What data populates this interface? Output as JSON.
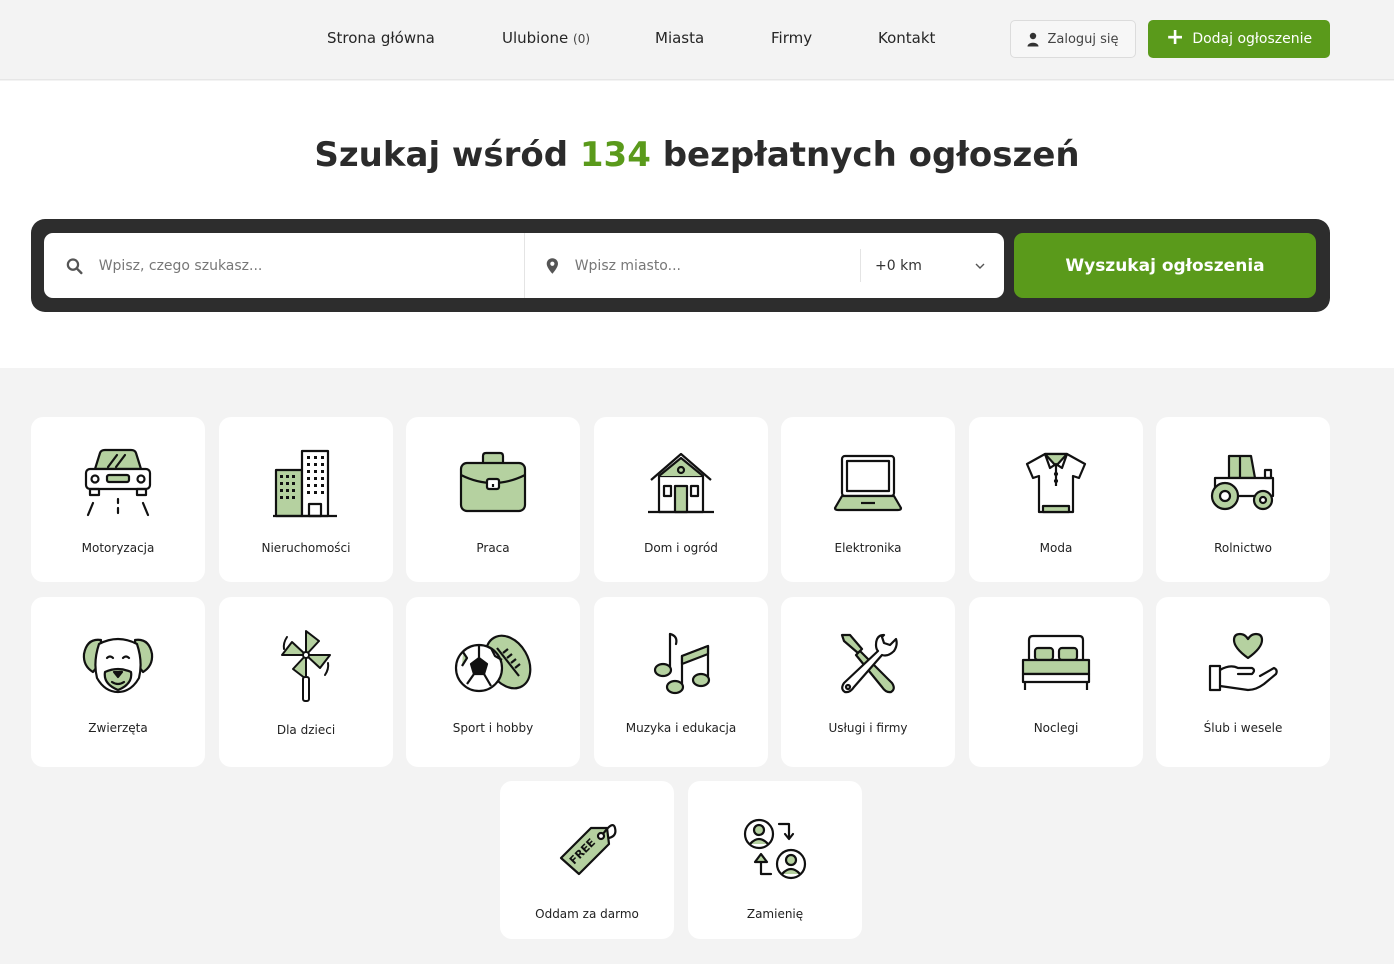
{
  "nav": {
    "items": [
      {
        "label": "Strona główna"
      },
      {
        "label": "Ulubione",
        "count": "(0)"
      },
      {
        "label": "Miasta"
      },
      {
        "label": "Firmy"
      },
      {
        "label": "Kontakt"
      }
    ],
    "login_label": "Zaloguj się",
    "add_label": "Dodaj ogłoszenie"
  },
  "hero": {
    "title_start": "Szukaj wśród ",
    "count": "134",
    "title_end": "bezpłatnych ogłoszeń"
  },
  "search": {
    "query_placeholder": "Wpisz, czego szukasz...",
    "city_placeholder": "Wpisz miasto...",
    "radius": "+0 km",
    "button_label": "Wyszukaj ogłoszenia"
  },
  "categories": [
    {
      "label": "Motoryzacja",
      "icon": "car-icon"
    },
    {
      "label": "Nieruchomości",
      "icon": "buildings-icon"
    },
    {
      "label": "Praca",
      "icon": "briefcase-icon"
    },
    {
      "label": "Dom i ogród",
      "icon": "house-icon"
    },
    {
      "label": "Elektronika",
      "icon": "laptop-icon"
    },
    {
      "label": "Moda",
      "icon": "shirt-icon"
    },
    {
      "label": "Rolnictwo",
      "icon": "tractor-icon"
    },
    {
      "label": "Zwierzęta",
      "icon": "dog-icon"
    },
    {
      "label": "Dla dzieci",
      "icon": "pinwheel-icon"
    },
    {
      "label": "Sport i hobby",
      "icon": "balls-icon"
    },
    {
      "label": "Muzyka i edukacja",
      "icon": "music-notes-icon"
    },
    {
      "label": "Usługi i firmy",
      "icon": "tools-icon"
    },
    {
      "label": "Noclegi",
      "icon": "bed-icon"
    },
    {
      "label": "Ślub i wesele",
      "icon": "heart-hand-icon"
    },
    {
      "label": "Oddam za darmo",
      "icon": "free-tag-icon",
      "tag_text": "FREE"
    },
    {
      "label": "Zamienię",
      "icon": "swap-users-icon"
    }
  ],
  "colors": {
    "accent": "#5a9a1b",
    "icon_fill": "#b5d1a0",
    "dark": "#2d2d2d"
  }
}
